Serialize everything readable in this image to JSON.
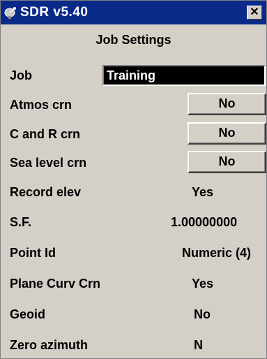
{
  "window": {
    "title": "SDR v5.40",
    "close_glyph": "✕",
    "icon": "satellite-dish-icon"
  },
  "header": {
    "title": "Job Settings"
  },
  "fields": {
    "job": {
      "label": "Job",
      "value": "Training"
    },
    "atmos": {
      "label": "Atmos crn",
      "value": "No"
    },
    "cr": {
      "label": "C and R crn",
      "value": "No"
    },
    "sea": {
      "label": "Sea level crn",
      "value": "No"
    },
    "record_elev": {
      "label": "Record elev",
      "value": "Yes"
    },
    "sf": {
      "label": "S.F.",
      "value": "1.00000000"
    },
    "point_id": {
      "label": "Point Id",
      "value": "Numeric (4)"
    },
    "plane_curv": {
      "label": "Plane Curv Crn",
      "value": "Yes"
    },
    "geoid": {
      "label": "Geoid",
      "value": "No"
    },
    "zero_azimuth": {
      "label": "Zero azimuth",
      "value": "N"
    }
  },
  "colors": {
    "titlebar": "#0a2a8a",
    "window_bg": "#d4d0c8",
    "input_bg": "#000000"
  }
}
